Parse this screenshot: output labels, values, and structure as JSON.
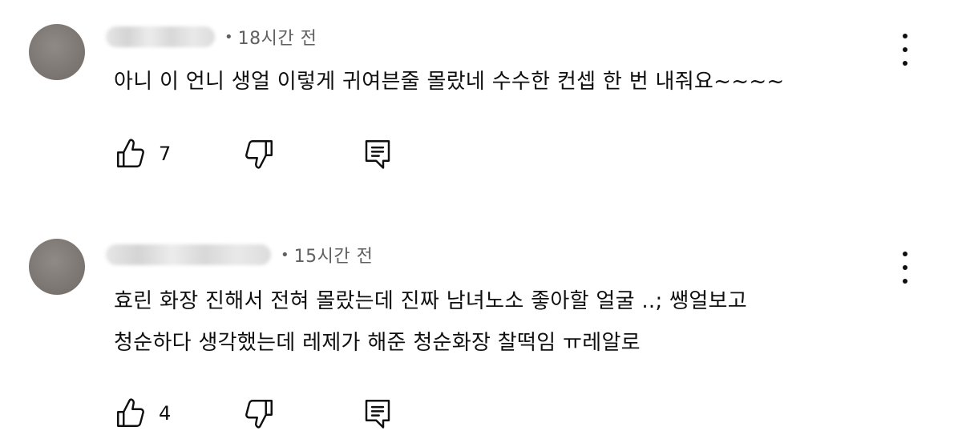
{
  "comments": [
    {
      "time": "18시간 전",
      "text_lines": [
        "아니 이 언니 생얼 이렇게 귀여븐줄 몰랐네 수수한 컨셉 한 번 내줘요~~~~"
      ],
      "likes": "7"
    },
    {
      "time": "15시간 전",
      "text_lines": [
        "효린 화장 진해서 전혀 몰랐는데 진짜 남녀노소 좋아할 얼굴 ..; 쌩얼보고",
        "청순하다 생각했는데 레제가 해준 청순화장 찰떡임 ㅠ레알로"
      ],
      "likes": "4"
    }
  ],
  "separator": "•",
  "icons": {
    "like": "thumbs-up-icon",
    "dislike": "thumbs-down-icon",
    "reply": "reply-comment-icon",
    "menu": "more-vertical-icon"
  },
  "colors": {
    "text": "#0f0f0f",
    "secondary": "#606060"
  }
}
